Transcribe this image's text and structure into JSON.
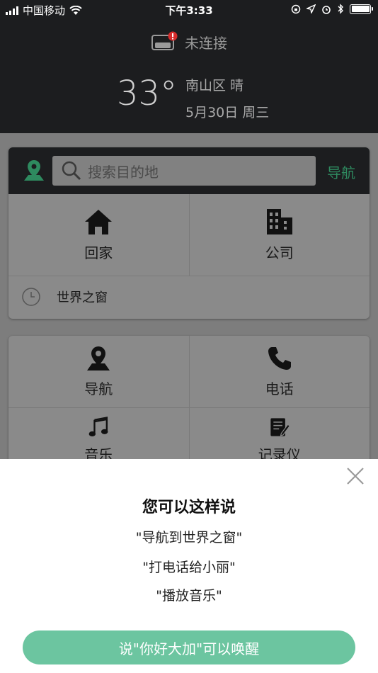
{
  "status_bar": {
    "carrier": "中国移动",
    "time": "下午3:33"
  },
  "header": {
    "connection_status": "未连接",
    "temperature": "33°",
    "location_weather": "南山区 晴",
    "date": "5月30日 周三"
  },
  "search": {
    "placeholder": "搜索目的地",
    "nav_label": "导航"
  },
  "shortcuts": {
    "home": "回家",
    "company": "公司",
    "recent": "世界之窗"
  },
  "apps": {
    "navigation": "导航",
    "phone": "电话",
    "music": "音乐",
    "notes": "记录仪"
  },
  "sheet": {
    "title": "您可以这样说",
    "suggestions": [
      "\"导航到世界之窗\"",
      "\"打电话给小丽\"",
      "\"播放音乐\""
    ],
    "wake_button": "说\"你好大加\"可以唤醒"
  },
  "colors": {
    "accent_green": "#6cc5a0",
    "nav_green": "#2e8a5f",
    "dark_bg": "#1c1d1f"
  }
}
